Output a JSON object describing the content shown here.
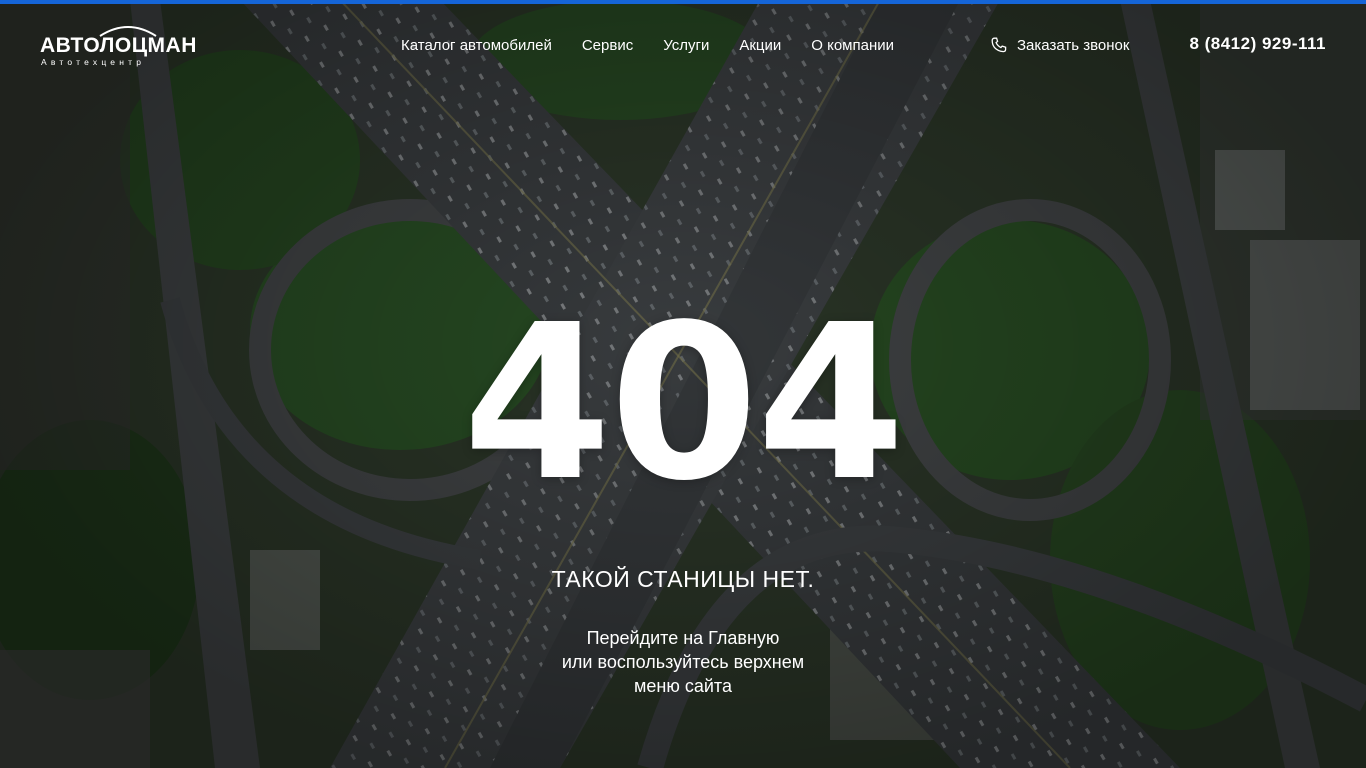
{
  "header": {
    "logo_main": "АВТОЛОЦМАН",
    "logo_sub": "Автотехцентр",
    "nav": [
      {
        "label": "Каталог автомобилей"
      },
      {
        "label": "Сервис"
      },
      {
        "label": "Услуги"
      },
      {
        "label": "Акции"
      },
      {
        "label": "О компании"
      }
    ],
    "callback_label": "Заказать звонок",
    "callback_icon": "phone-icon",
    "phone": "8 (8412) 929-111"
  },
  "error": {
    "code": "404",
    "headline": "ТАКОЙ СТАНИЦЫ НЕТ.",
    "hint_line1": "Перейдите на Главную",
    "hint_line2": "или воспользуйтесь верхнем",
    "hint_line3": "меню сайта"
  },
  "colors": {
    "accent": "#1565d8",
    "text": "#ffffff"
  }
}
